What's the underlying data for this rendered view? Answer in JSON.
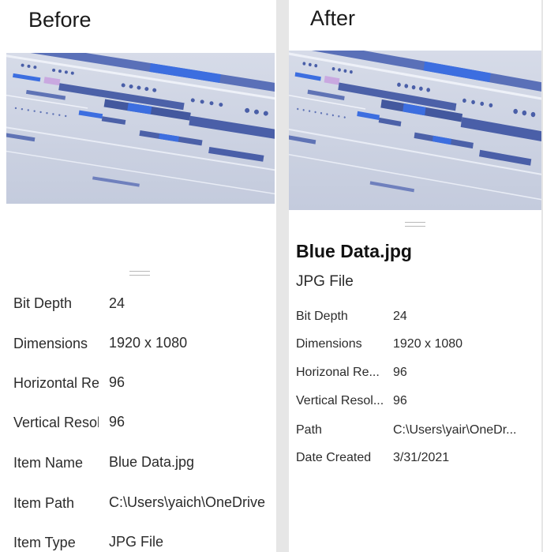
{
  "before": {
    "heading": "Before",
    "properties": [
      {
        "label": "Bit Depth",
        "value": "24"
      },
      {
        "label": "Dimensions",
        "value": "1920 x 1080"
      },
      {
        "label": "Horizontal Res",
        "value": "96"
      },
      {
        "label": "Vertical Resolu",
        "value": "96"
      },
      {
        "label": "Item Name",
        "value": "Blue Data.jpg"
      },
      {
        "label": "Item Path",
        "value": "C:\\Users\\yaich\\OneDrive"
      },
      {
        "label": "Item Type",
        "value": "JPG File"
      }
    ]
  },
  "after": {
    "heading": "After",
    "file_name": "Blue Data.jpg",
    "file_type": "JPG File",
    "properties": [
      {
        "label": "Bit Depth",
        "value": "24"
      },
      {
        "label": "Dimensions",
        "value": "1920 x 1080"
      },
      {
        "label": "Horizonal Re...",
        "value": "96"
      },
      {
        "label": "Vertical Resol...",
        "value": "96"
      },
      {
        "label": "Path",
        "value": "C:\\Users\\yair\\OneDr..."
      },
      {
        "label": "Date Created",
        "value": "3/31/2021"
      }
    ]
  },
  "colors": {
    "page_background": "#e6e6e6",
    "panel_background": "#ffffff",
    "image_background": "#c9d0e2",
    "data_blue": "#4a6fd6"
  },
  "icons": {
    "preview_image": "abstract-blue-data-image",
    "drag_handle": "grip-handle-icon"
  }
}
